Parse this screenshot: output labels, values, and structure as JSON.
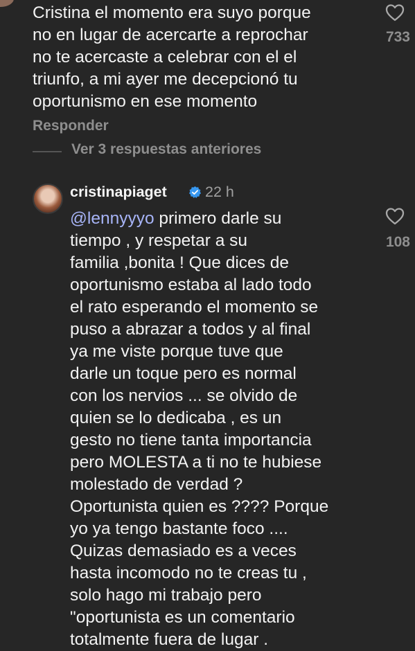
{
  "first_comment": {
    "text": "Cristina el momento era suyo porque\nno en lugar de acercarte a reprochar\nno te acercaste a celebrar con el el\ntriunfo, a mi ayer me decepcionó tu\noportunismo en ese momento",
    "likes": "733",
    "reply_label": "Responder"
  },
  "view_replies_label": "Ver 3 respuestas anteriores",
  "reply": {
    "username": "cristinapiaget",
    "time": "22 h",
    "mention": "@lennyyyo",
    "text": " primero darle su\ntiempo , y respetar a su\nfamilia ,bonita ! Que dices de\noportunismo estaba al lado todo\nel rato esperando el momento se\npuso a abrazar a todos y al final\nya  me viste porque tuve que\ndarle un toque pero es normal\ncon los nervios ... se olvido de\nquien se lo dedicaba , es un\ngesto no tiene tanta importancia\npero MOLESTA a ti no te hubiese\nmolestado de verdad ?\nOportunista quien es ???? Porque\nyo ya tengo bastante foco ....\nQuizas demasiado es a veces\nhasta incomodo no te creas tu ,\nsolo hago mi trabajo pero\n\"oportunista es un comentario\ntotalmente fuera de lugar .",
    "likes": "108"
  },
  "colors": {
    "background": "#262626",
    "text": "#f3f3f3",
    "secondary": "#8e8e8e",
    "mention": "#a7b4f7",
    "verified": "#3797f0"
  },
  "icons": {
    "like": "heart-outline-icon",
    "verified": "verified-badge-icon"
  }
}
